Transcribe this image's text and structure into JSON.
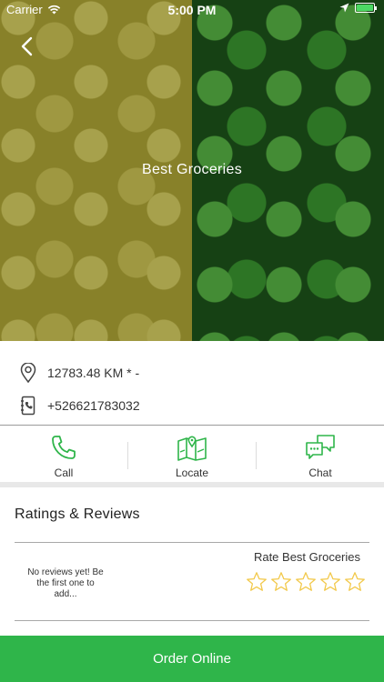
{
  "status_bar": {
    "carrier": "Carrier",
    "time": "5:00 PM"
  },
  "hero": {
    "title": "Best Groceries",
    "back_icon": "chevron-left-icon"
  },
  "info": {
    "distance": "12783.48 KM * -",
    "phone": "+526621783032",
    "location_icon": "map-pin-icon",
    "phone_icon": "phone-book-icon"
  },
  "actions": [
    {
      "label": "Call",
      "icon": "phone-icon"
    },
    {
      "label": "Locate",
      "icon": "map-icon"
    },
    {
      "label": "Chat",
      "icon": "chat-icon"
    }
  ],
  "ratings": {
    "title": "Ratings & Reviews",
    "no_reviews_text": "No reviews yet! Be the first one to add...",
    "rate_title": "Rate Best Groceries",
    "star_count": 5,
    "current_rating": 0
  },
  "order": {
    "label": "Order Online"
  },
  "colors": {
    "accent": "#2fb54a",
    "star": "#f2c94c"
  }
}
